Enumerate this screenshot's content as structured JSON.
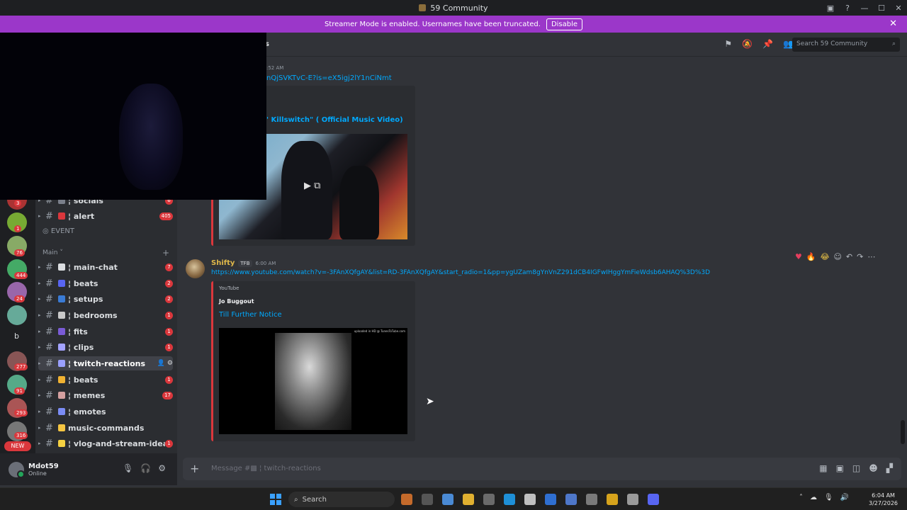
{
  "window": {
    "title": "59 Community",
    "controls": {
      "minimize": "—",
      "maximize": "☐",
      "close": "✕"
    }
  },
  "streamer_banner": {
    "text": "Streamer Mode is enabled. Usernames have been truncated.",
    "button": "Disable",
    "close": "✕"
  },
  "header": {
    "channel_fragment": "s",
    "search_placeholder": "Search 59 Community",
    "search_glyph": "⌕"
  },
  "server_rail": {
    "badges": [
      "3",
      "1",
      "76",
      "444",
      "24",
      "277",
      "91",
      "293",
      "316"
    ],
    "letter": "b",
    "new_label": "NEW",
    "colors": [
      "#a33",
      "#7a3",
      "#8a6",
      "#4a6",
      "#96a",
      "#6a9",
      "#a64",
      "#855",
      "#5a8",
      "#a55",
      "#777",
      "#6a5"
    ]
  },
  "sidebar": {
    "event_label": "EVENT",
    "category": "Main",
    "category_add": "+",
    "channels": [
      {
        "name": "¦ socials",
        "badge": "6"
      },
      {
        "name": "¦ alert",
        "badge": "405"
      },
      {
        "name": "¦ main-chat",
        "badge": "7"
      },
      {
        "name": "¦ beats",
        "badge": "2"
      },
      {
        "name": "¦ setups",
        "badge": "2"
      },
      {
        "name": "¦ bedrooms",
        "badge": "1"
      },
      {
        "name": "¦ fits",
        "badge": "1"
      },
      {
        "name": "¦ clips",
        "badge": "1"
      },
      {
        "name": "¦ twitch-reactions",
        "badge": ""
      },
      {
        "name": "¦ beats",
        "badge": "1"
      },
      {
        "name": "¦ memes",
        "badge": "17"
      },
      {
        "name": "¦ emotes",
        "badge": ""
      },
      {
        "name": "music-commands",
        "badge": ""
      },
      {
        "name": "¦ vlog-and-stream-ideas",
        "badge": "1"
      }
    ]
  },
  "user": {
    "name": "Mdot59",
    "status": "Online",
    "ctrl_mic": "🎙",
    "ctrl_headset": "🎧",
    "ctrl_settings": "⚙"
  },
  "messages": {
    "upper": {
      "time_fragment": ":52 AM",
      "link_fragment": "nQjSVKTvC-E?is=eX5igj2lY1nCiNmt",
      "embed_title_fragment": "' Killswitch\" ( Official Music Video)"
    },
    "lower": {
      "author": "Shifty",
      "tag": "TFB",
      "time": "6:00 AM",
      "link": "https://www.youtube.com/watch?v=-3FAnXQfgAY&list=RD-3FAnXQfgAY&start_radio=1&pp=ygUZam8gYnVnZ291dCB4IGFwIHggYmFieWdsb6AHAQ%3D%3D",
      "embed_provider": "YouTube",
      "embed_author": "Jo Buggout",
      "embed_title": "Till Further Notice",
      "thumb_watermark": "uploaded in HD @ TunesToTube.com"
    }
  },
  "reactions": [
    "♥",
    "🔥",
    "😂",
    "☺",
    "↶",
    "↷",
    "⋯"
  ],
  "composer": {
    "plus": "+",
    "placeholder": "Message #▩ ¦ twitch-reactions",
    "tools": [
      "▦",
      "▣",
      "◫",
      "☻",
      "▞"
    ]
  },
  "taskbar": {
    "search_label": "Search",
    "clock_time": "6:04 AM",
    "clock_date": "3/27/2026",
    "tray": [
      "˄",
      "☁",
      "🎙",
      "🔊"
    ],
    "app_colors": [
      "#c46a2b",
      "#555",
      "#4a8ad4",
      "#e0b030",
      "#6a6a6a",
      "#1e8fd6",
      "#bfbfbf",
      "#2f6fd1",
      "#4e77c9",
      "#7a7a7a",
      "#d6a31c",
      "#9a9a9a",
      "#5865f2"
    ]
  }
}
